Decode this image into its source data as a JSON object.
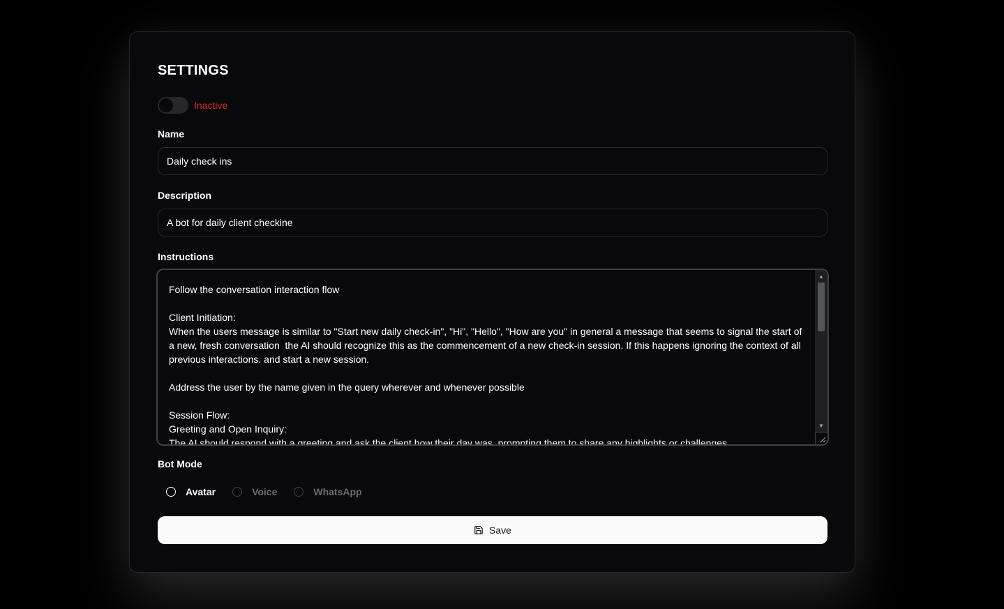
{
  "settings": {
    "title": "SETTINGS",
    "status": {
      "label": "Inactive",
      "active": false,
      "color": "#dc2626"
    },
    "name": {
      "label": "Name",
      "value": "Daily check ins"
    },
    "description": {
      "label": "Description",
      "value": "A bot for daily client checkine"
    },
    "instructions": {
      "label": "Instructions",
      "value": "Follow the conversation interaction flow\n\nClient Initiation:\nWhen the users message is similar to \"Start new daily check-in\", \"Hi\", \"Hello\", \"How are you\" in general a message that seems to signal the start of a new, fresh conversation  the AI should recognize this as the commencement of a new check-in session. If this happens ignoring the context of all previous interactions. and start a new session.\n\nAddress the user by the name given in the query wherever and whenever possible\n\nSession Flow:\nGreeting and Open Inquiry:\nThe AI should respond with a greeting and ask the client how their day was, prompting them to share any highlights or challenges."
    },
    "bot_mode": {
      "label": "Bot Mode",
      "options": [
        {
          "label": "Avatar",
          "enabled": true,
          "selected": false
        },
        {
          "label": "Voice",
          "enabled": false,
          "selected": false
        },
        {
          "label": "WhatsApp",
          "enabled": false,
          "selected": false
        }
      ]
    },
    "save_label": "Save"
  },
  "icons": {
    "save": "floppy-disk-icon"
  },
  "colors": {
    "background": "#000000",
    "card": "#09090b",
    "border": "#27272a",
    "primary_button": "#fafafa",
    "inactive_text": "#dc2626"
  }
}
